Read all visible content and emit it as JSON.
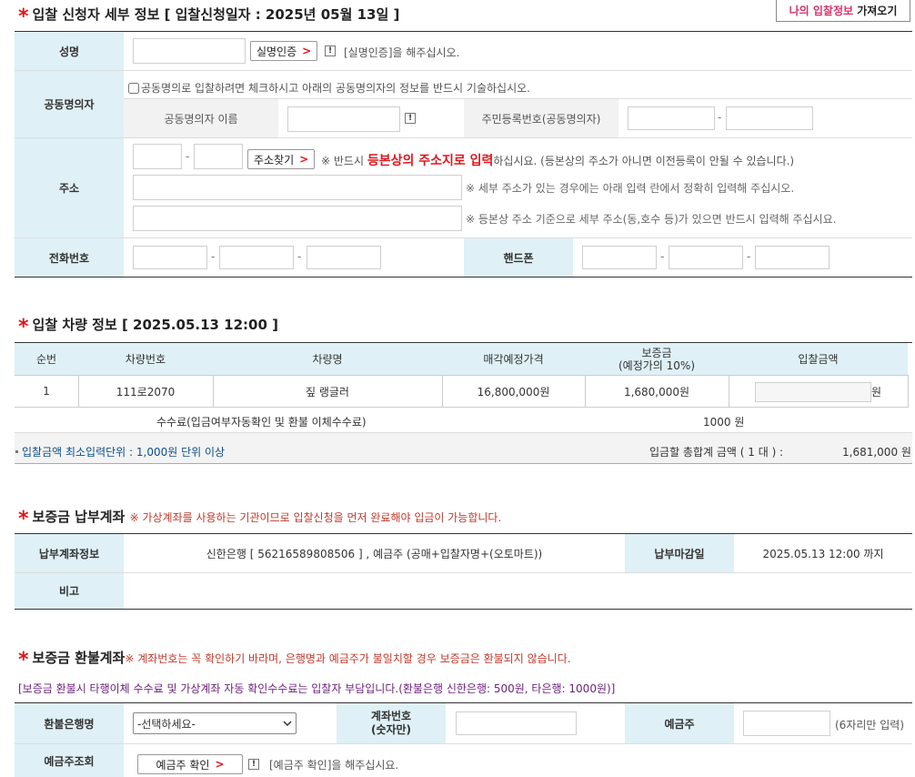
{
  "applicant": {
    "title": "입찰 신청자 세부 정보 [ 입찰신청일자 : 2025년 05월 13일 ]",
    "load_button": {
      "pink": "나의 입찰정보",
      "dark": "가져오기"
    },
    "name": {
      "label": "성명",
      "value": "",
      "verify_button": "실명인증",
      "help": "[실명인증]을 해주십시오."
    },
    "joint": {
      "label": "공동명의자",
      "checkbox_text": "공동명의로 입찰하려면 체크하시고 아래의 공동명의자의 정보를 반드시 기술하십시오.",
      "name_label": "공동명의자 이름",
      "rrn_label": "주민등록번호(공동명의자)"
    },
    "address": {
      "label": "주소",
      "search_button": "주소찾기",
      "note_prefix": "※ 반드시 ",
      "note_highlight": "등본상의 주소지로 입력",
      "note_suffix": "하십시요. (등본상의 주소가 아니면 이전등록이 안될 수 있습니다.)",
      "note2": "※ 세부 주소가 있는 경우에는 아래 입력 란에서 정확히 입력해 주십시오.",
      "note3": "※ 등본상 주소 기준으로 세부 주소(동,호수 등)가 있으면 반드시 입력해 주십시요."
    },
    "phone_label": "전화번호",
    "mobile_label": "핸드폰"
  },
  "vehicle": {
    "title": "입찰 차량 정보 [ 2025.05.13 12:00 ]",
    "headers": [
      "순번",
      "차량번호",
      "차량명",
      "매각예정가격",
      "보증금",
      "(예정가의 10%)",
      "입찰금액"
    ],
    "row": {
      "no": "1",
      "plate": "111로2070",
      "name": "짚 랭글러",
      "price": "16,800,000원",
      "deposit": "1,680,000원",
      "bid_unit": "원"
    },
    "fee_label": "수수료(입금여부자동확인 및 환불 이체수수료)",
    "fee_value": "1000 원",
    "min_unit_note": "입찰금액 최소입력단위 : 1,000원 단위 이상",
    "total_label": "입금할 총합계 금액 ( 1 대 ) :",
    "total_value": "1,681,000 원"
  },
  "payment": {
    "title": "보증금 납부계좌",
    "note": "※ 가상계좌를 사용하는 기관이므로 입찰신청을 먼저 완료해야 입금이 가능합니다.",
    "account_label": "납부계좌정보",
    "account_value": "신한은행 [ 56216589808506 ] , 예금주 (공매+입찰자명+(오토마트))",
    "deadline_label": "납부마감일",
    "deadline_value": "2025.05.13 12:00 까지",
    "remark_label": "비고"
  },
  "refund": {
    "title": "보증금 환불계좌",
    "note": "※ 계좌번호는 꼭 확인하기 바라며, 은행명과 예금주가 불일치할 경우 보증금은 환불되지 않습니다.",
    "fee_note": "[보증금 환불시 타행이체 수수료 및 가상계좌 자동 확인수수료는 입찰자 부담입니다.(환불은행 신한은행: 500원, 타은행: 1000원)]",
    "bank_label": "환불은행명",
    "bank_selected": "-선택하세요-",
    "account_label_1": "계좌번호",
    "account_label_2": "(숫자만)",
    "holder_label": "예금주",
    "holder_hint": "(6자리만 입력)",
    "verify_label": "예금주조회",
    "verify_button": "예금주 확인",
    "verify_help": "[예금주 확인]을 해주십시요."
  }
}
